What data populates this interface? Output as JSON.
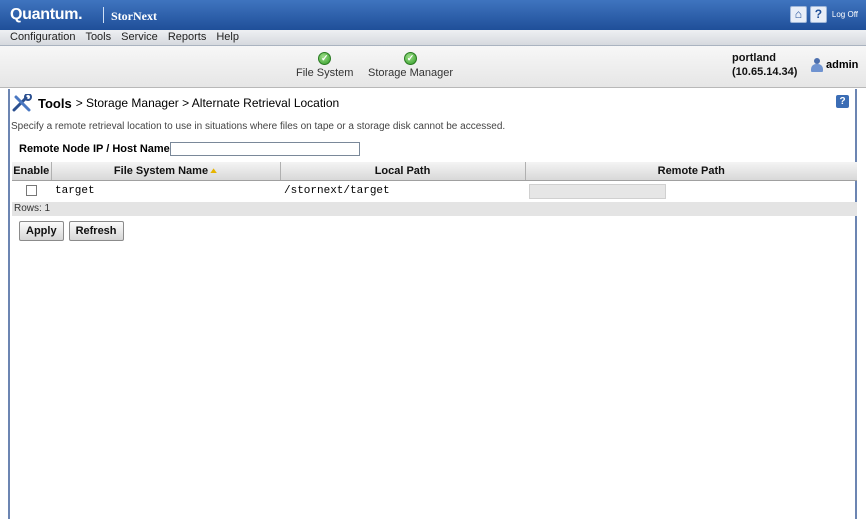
{
  "header": {
    "brand": "Quantum.",
    "product": "StorNext",
    "home_label": "⌂",
    "help_label": "?",
    "logoff_label": "Log Off"
  },
  "menu": [
    "Configuration",
    "Tools",
    "Service",
    "Reports",
    "Help"
  ],
  "status": {
    "services": [
      {
        "label": "File System",
        "state": "ok"
      },
      {
        "label": "Storage Manager",
        "state": "ok"
      }
    ],
    "host_name": "portland",
    "host_ip": "(10.65.14.34)",
    "user": "admin"
  },
  "page": {
    "section": "Tools",
    "breadcrumb_rest": "> Storage Manager > Alternate Retrieval Location",
    "help_label": "?",
    "description": "Specify a remote retrieval location to use in situations where files on tape or a storage disk cannot be accessed.",
    "remote_label": "Remote Node IP / Host Name",
    "remote_value": ""
  },
  "table": {
    "columns": [
      "Enable",
      "File System Name",
      "Local Path",
      "Remote Path"
    ],
    "rows": [
      {
        "enabled": false,
        "file_system": "target",
        "local_path": "/stornext/target",
        "remote_path": ""
      }
    ],
    "rows_label": "Rows: 1"
  },
  "actions": {
    "apply_label": "Apply",
    "refresh_label": "Refresh"
  },
  "colors": {
    "header_blue": "#1f4f99",
    "ok_green": "#2e9a25",
    "sort_arrow": "#e6b400"
  }
}
